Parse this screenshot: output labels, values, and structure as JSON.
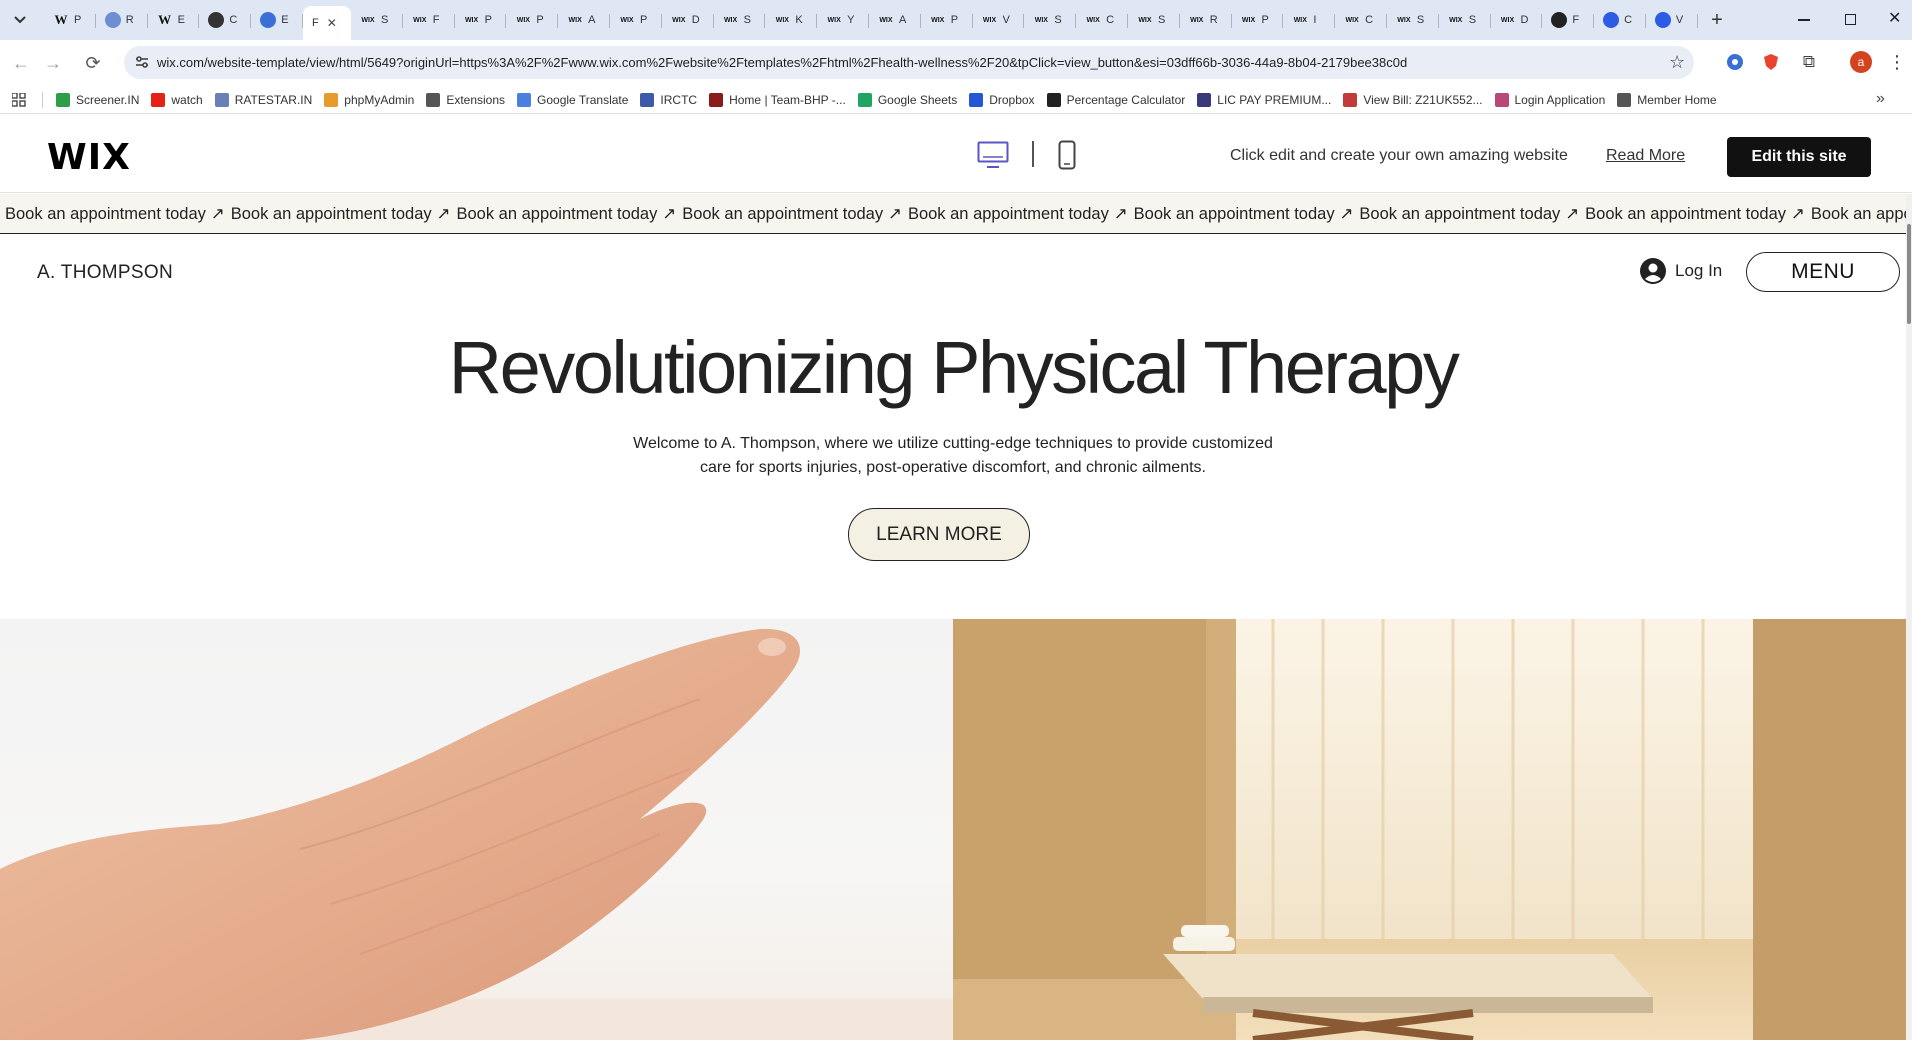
{
  "browser": {
    "tabs": [
      {
        "icon": "wikipedia-icon",
        "letter": "P",
        "color": "#ffffff"
      },
      {
        "icon": "globe-icon",
        "letter": "R",
        "color": "#ffffff"
      },
      {
        "icon": "wikipedia-icon",
        "letter": "E",
        "color": "#ffffff"
      },
      {
        "icon": "chatgpt-icon",
        "letter": "C",
        "color": "#ffffff"
      },
      {
        "icon": "star-icon",
        "letter": "E",
        "color": "#ffffff"
      },
      {
        "icon": "wix-icon",
        "letter": "S",
        "color": "#ffffff"
      },
      {
        "icon": "wix-icon",
        "letter": "F",
        "color": "#ffffff"
      },
      {
        "icon": "wix-icon",
        "letter": "P",
        "color": "#ffffff"
      },
      {
        "icon": "wix-icon",
        "letter": "P",
        "color": "#ffffff"
      },
      {
        "icon": "wix-icon",
        "letter": "A",
        "color": "#ffffff"
      },
      {
        "icon": "wix-icon",
        "letter": "P",
        "color": "#ffffff"
      },
      {
        "icon": "wix-icon",
        "letter": "D",
        "color": "#ffffff"
      },
      {
        "icon": "wix-icon",
        "letter": "S",
        "color": "#ffffff"
      },
      {
        "icon": "wix-icon",
        "letter": "K",
        "color": "#ffffff"
      },
      {
        "icon": "wix-icon",
        "letter": "Y",
        "color": "#ffffff"
      },
      {
        "icon": "wix-icon",
        "letter": "A",
        "color": "#ffffff"
      },
      {
        "icon": "wix-icon",
        "letter": "P",
        "color": "#ffffff"
      },
      {
        "icon": "wix-icon",
        "letter": "V",
        "color": "#ffffff"
      },
      {
        "icon": "wix-icon",
        "letter": "S",
        "color": "#ffffff"
      },
      {
        "icon": "wix-icon",
        "letter": "C",
        "color": "#ffffff"
      },
      {
        "icon": "wix-icon",
        "letter": "S",
        "color": "#ffffff"
      },
      {
        "icon": "wix-icon",
        "letter": "R",
        "color": "#ffffff"
      },
      {
        "icon": "wix-icon",
        "letter": "P",
        "color": "#ffffff"
      },
      {
        "icon": "wix-icon",
        "letter": "I",
        "color": "#ffffff"
      },
      {
        "icon": "wix-icon",
        "letter": "C",
        "color": "#ffffff"
      },
      {
        "icon": "wix-icon",
        "letter": "S",
        "color": "#ffffff"
      },
      {
        "icon": "wix-icon",
        "letter": "S",
        "color": "#ffffff"
      },
      {
        "icon": "wix-icon",
        "letter": "D",
        "color": "#ffffff"
      },
      {
        "icon": "feather-icon",
        "letter": "F",
        "color": "#ffffff"
      },
      {
        "icon": "blue-w-icon",
        "letter": "C",
        "color": "#ffffff"
      },
      {
        "icon": "blue-w-icon",
        "letter": "V",
        "color": "#ffffff"
      }
    ],
    "active_tab": {
      "letter": "F",
      "close": "✕",
      "insert_after": 4
    },
    "new_tab": "+",
    "url": "wix.com/website-template/view/html/5649?originUrl=https%3A%2F%2Fwww.wix.com%2Fwebsite%2Ftemplates%2Fhtml%2Fhealth-wellness%2F20&tpClick=view_button&esi=03dff66b-3036-44a9-8b04-2179bee38c0d",
    "profile_letter": "a",
    "bookmarks": [
      {
        "label": "Screener.IN",
        "icon": "bar-chart-icon",
        "color": "#2e9e4a"
      },
      {
        "label": "watch",
        "icon": "youtube-icon",
        "color": "#e62117"
      },
      {
        "label": "RATESTAR.IN",
        "icon": "ratestar-icon",
        "color": "#6a7fb5"
      },
      {
        "label": "phpMyAdmin",
        "icon": "phpmyadmin-icon",
        "color": "#e79b2a"
      },
      {
        "label": "Extensions",
        "icon": "puzzle-icon",
        "color": "#555555"
      },
      {
        "label": "Google Translate",
        "icon": "translate-icon",
        "color": "#4a7fe0"
      },
      {
        "label": "IRCTC",
        "icon": "irctc-icon",
        "color": "#3d5aa8"
      },
      {
        "label": "Home | Team-BHP -...",
        "icon": "teambhp-icon",
        "color": "#8b1a1a"
      },
      {
        "label": "Google Sheets",
        "icon": "sheets-icon",
        "color": "#1fa463"
      },
      {
        "label": "Dropbox",
        "icon": "dropbox-icon",
        "color": "#2457d6"
      },
      {
        "label": "Percentage Calculator",
        "icon": "percent-icon",
        "color": "#222222"
      },
      {
        "label": "LIC PAY PREMIUM...",
        "icon": "lic-icon",
        "color": "#3a3a7a"
      },
      {
        "label": "View Bill: Z21UK552...",
        "icon": "bill-icon",
        "color": "#c33a3a"
      },
      {
        "label": "Login Application",
        "icon": "login-app-icon",
        "color": "#b8477a"
      },
      {
        "label": "Member Home",
        "icon": "globe-icon",
        "color": "#555555"
      }
    ]
  },
  "wix": {
    "logo": "WIX",
    "hint": "Click edit and create your own amazing website",
    "read_more": "Read More",
    "edit_button": "Edit this site"
  },
  "marquee": {
    "text": "Book an appointment today",
    "arrow": "↗",
    "repeat": 9
  },
  "site": {
    "brand": "A. THOMPSON",
    "login": "Log In",
    "menu": "MENU",
    "hero_title": "Revolutionizing Physical Therapy",
    "hero_subtitle_line1": "Welcome to A. Thompson, where we utilize cutting-edge techniques to provide customized",
    "hero_subtitle_line2": "care for sports injuries, post-operative discomfort, and chronic ailments.",
    "cta": "LEARN MORE"
  },
  "images": {
    "left": "hand-photo",
    "right": "therapy-room-photo"
  }
}
